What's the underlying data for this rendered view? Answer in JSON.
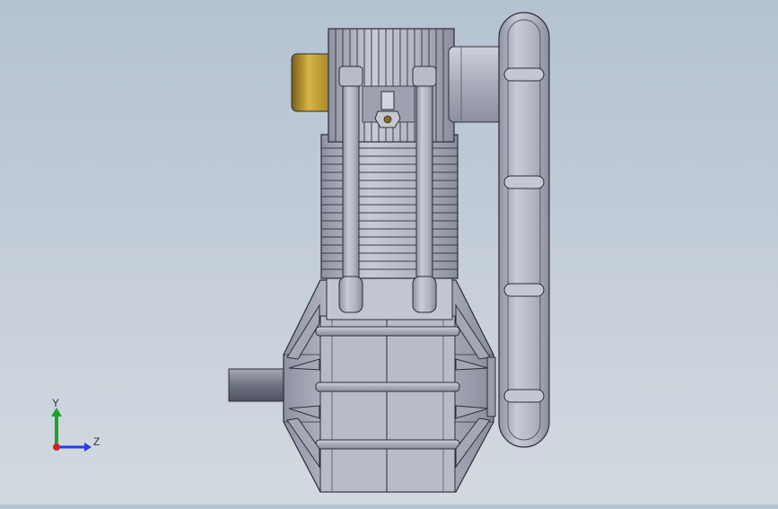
{
  "model": {
    "description_colors": {
      "background_top": "#b4c2d2",
      "background_bottom": "#d3d9e0",
      "metal_light": "#c9cbd6",
      "metal_mid": "#a6a9b8",
      "metal_dark": "#7e8192",
      "edge": "#2b2d36",
      "brass": "#c9a63a",
      "shaft": "#8a8c96"
    }
  },
  "triad": {
    "y_label": "Y",
    "z_label": "Z",
    "y_color": "#1ea32a",
    "z_color": "#2b3cd8",
    "x_color": "#d3202a"
  }
}
